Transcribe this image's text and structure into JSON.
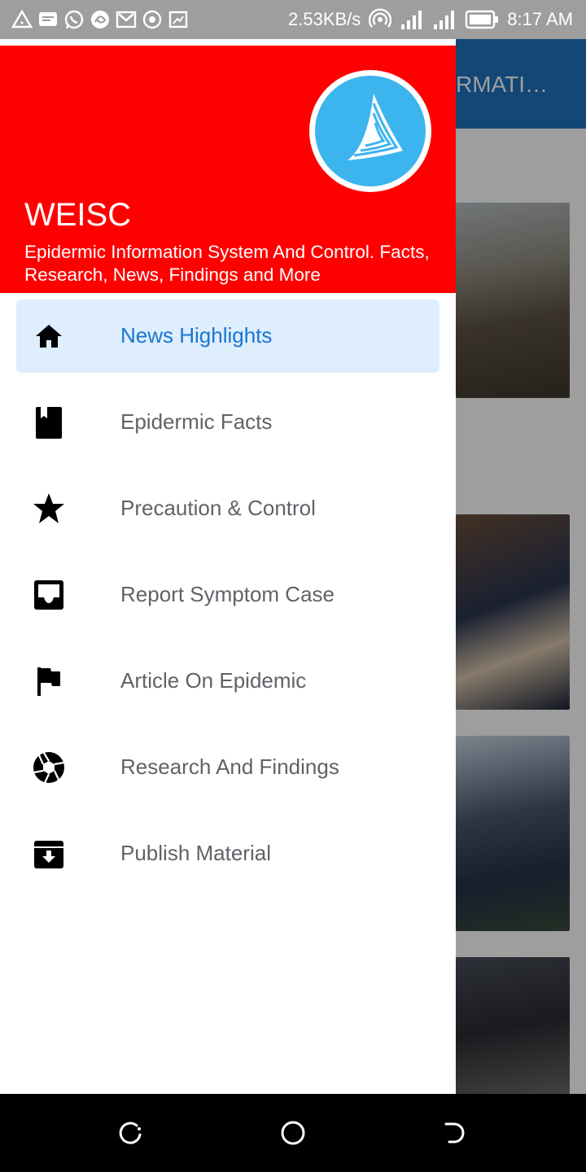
{
  "status_bar": {
    "network_speed": "2.53KB/s",
    "time": "8:17 AM",
    "left_icons": [
      "warning-triangle-icon",
      "message-icon",
      "whatsapp-icon",
      "browser-icon",
      "gmail-icon",
      "record-icon",
      "screenshot-icon"
    ],
    "right_icons": [
      "hotspot-icon",
      "signal-ht-icon",
      "signal-icon",
      "battery-icon"
    ]
  },
  "background_app": {
    "title_fragment": "RMATI…",
    "app_bar_color": "#1e73be"
  },
  "drawer": {
    "header_color": "#ff0000",
    "app_name": "WEISC",
    "description": "Epidermic Information System And Control. Facts, Research, News, Findings and More",
    "logo_icon": "sail-logo-icon",
    "items": [
      {
        "label": "News Highlights",
        "icon": "home-icon",
        "active": true
      },
      {
        "label": "Epidermic Facts",
        "icon": "book-icon",
        "active": false
      },
      {
        "label": "Precaution & Control",
        "icon": "star-icon",
        "active": false
      },
      {
        "label": "Report Symptom Case",
        "icon": "inbox-icon",
        "active": false
      },
      {
        "label": "Article On Epidemic",
        "icon": "flag-icon",
        "active": false
      },
      {
        "label": "Research And Findings",
        "icon": "aperture-icon",
        "active": false
      },
      {
        "label": "Publish Material",
        "icon": "archive-icon",
        "active": false
      }
    ],
    "active_color": "#1976d2",
    "active_bg": "#deeefd"
  },
  "nav_bar": {
    "buttons": [
      "recents-button",
      "home-button",
      "back-button"
    ]
  }
}
